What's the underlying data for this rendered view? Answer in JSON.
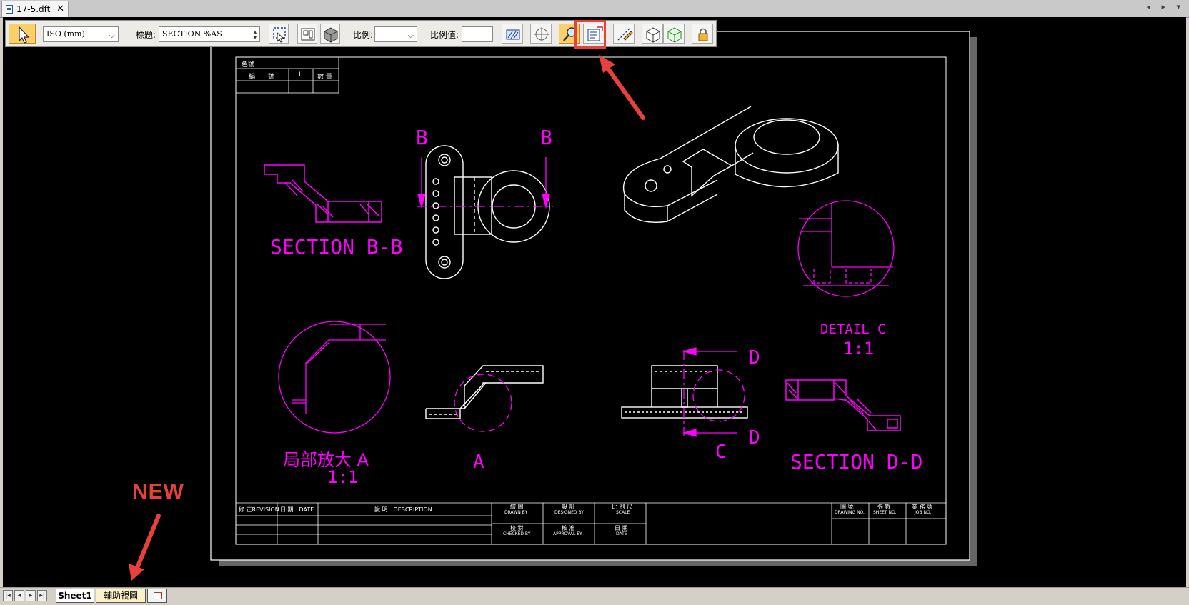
{
  "window": {
    "tab_title": "17-5.dft",
    "close_glyph": "✕",
    "controls": "◂ ▸ ▾"
  },
  "toolbar": {
    "select_icon": "arrow-cursor-icon",
    "standard_value": "ISO (mm)",
    "title_label": "標題:",
    "title_value": "SECTION %AS",
    "scale_label": "比例:",
    "scale_value": "",
    "scale_value_label": "比例值:",
    "scale_input": "",
    "icons": [
      "select-view-icon",
      "view-frame-icon",
      "shaded-cube-icon",
      "hatch-icon",
      "crosshair-icon",
      "zoom-icon",
      "properties-icon",
      "edit-line-icon",
      "wireframe-cube-icon",
      "green-cube-icon",
      "lock-icon"
    ],
    "highlighted_button": "properties-icon"
  },
  "drawing": {
    "labels": {
      "parts_header": "色號",
      "parts_col1": "編　　號",
      "parts_col2": "L",
      "parts_col3": "數 量",
      "section_bb": "SECTION B-B",
      "section_dd": "SECTION D-D",
      "detail_c": "DETAIL C",
      "detail_c_scale": "1:1",
      "detail_a": "局部放大 A",
      "detail_a_scale": "1:1",
      "view_a": "A",
      "cut_b_left": "B",
      "cut_b_right": "B",
      "cut_d_top": "D",
      "cut_d_bottom": "D",
      "cut_c": "C"
    },
    "title_block": {
      "revision": "修 正REVISION",
      "date": "日 期　DATE",
      "description": "說 明　DESCRIPTION",
      "drawn_by": "繪 圖",
      "drawn_by_en": "DRAWN BY",
      "designed_by": "設 計",
      "designed_by_en": "DESIGNED BY",
      "scale": "比 例 尺",
      "scale_en": "SCALE",
      "checked_by": "校 對",
      "checked_by_en": "CHECKED BY",
      "approval_by": "核 准",
      "approval_by_en": "APPROVAL BY",
      "date2": "日 期",
      "date2_en": "DATE",
      "drawing_no": "圖 號",
      "drawing_no_en": "DRAWING NO.",
      "sheet_no": "張 數",
      "sheet_no_en": "SHEET NO.",
      "job_no": "業 務 號",
      "job_no_en": "JOB NO."
    },
    "colors": {
      "linework": "#ffffff",
      "annotation": "#ff00ff",
      "background": "#000000"
    }
  },
  "annotations": {
    "new_label": "NEW",
    "accent_color": "#e8403b"
  },
  "sheets": {
    "nav_buttons": [
      "|◂",
      "◂",
      "▸",
      "▸|"
    ],
    "tabs": [
      "Sheet1",
      "輔助視圖"
    ],
    "active": "Sheet1",
    "add_icon": "new-sheet-icon"
  }
}
